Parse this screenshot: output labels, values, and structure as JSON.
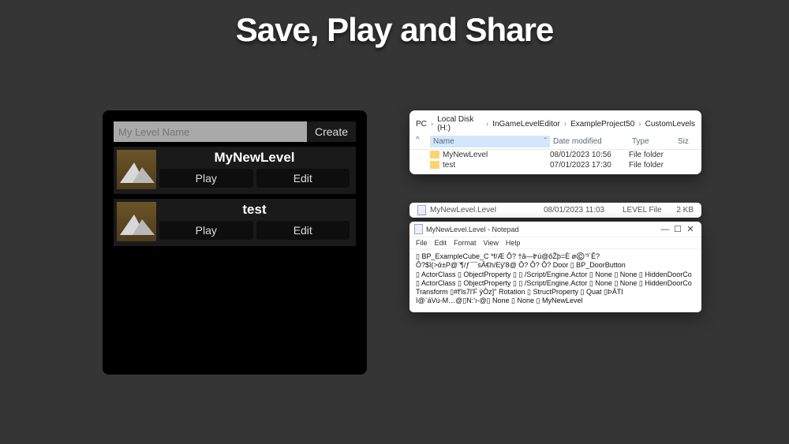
{
  "headline": "Save, Play and Share",
  "editor": {
    "input_placeholder": "My Level Name",
    "create_label": "Create",
    "play_label": "Play",
    "edit_label": "Edit",
    "levels": [
      {
        "name": "MyNewLevel"
      },
      {
        "name": "test"
      }
    ]
  },
  "explorer": {
    "crumbs": [
      "PC",
      "Local Disk (H:)",
      "InGameLevelEditor",
      "ExampleProject50",
      "CustomLevels"
    ],
    "columns": {
      "name": "Name",
      "date": "Date modified",
      "type": "Type",
      "size": "Siz"
    },
    "rows": [
      {
        "name": "MyNewLevel",
        "date": "08/01/2023 10:56",
        "type": "File folder"
      },
      {
        "name": "test",
        "date": "07/01/2023 17:30",
        "type": "File folder"
      }
    ]
  },
  "filerow": {
    "name": "MyNewLevel.Level",
    "date": "08/01/2023 11:03",
    "type": "LEVEL File",
    "size": "2 KB"
  },
  "notepad": {
    "title": "MyNewLevel.Level - Notepad",
    "menu": [
      "File",
      "Edit",
      "Format",
      "View",
      "Help"
    ],
    "lines": [
      "▯  BP_ExampleCube_C  *f/Æ                                    Õ?           †â—߈ú@ôŽþ=È ø©️'³´Ê?",
      "                      Ô?$î(>ά±P@¨¶/ƒ¯¯sÄ€h/Eÿ'8@    Ô?    Ô?    Ô?  Door    ▯  BP_DoorButton",
      "  ▯  ActorClass ▯  ObjectProperty ▯  ▯  /Script/Engine.Actor ▯  None ▯  None     ▯  HiddenDoorCo",
      "  ▯  ActorClass ▯  ObjectProperty ▯  ▯  /Script/Engine.Actor ▯  None ▯  None     ▯  HiddenDoorCo",
      "Transform                ▯#f'ls7l'F ÿÒz]''            Rotation  ▯  StructProperty    ▯    Quat          ▯ÞÄTI",
      "î@¨áVú-M…@▯N:'ı-@▯  None ▯  None    ▯  MyNewLevel"
    ]
  }
}
